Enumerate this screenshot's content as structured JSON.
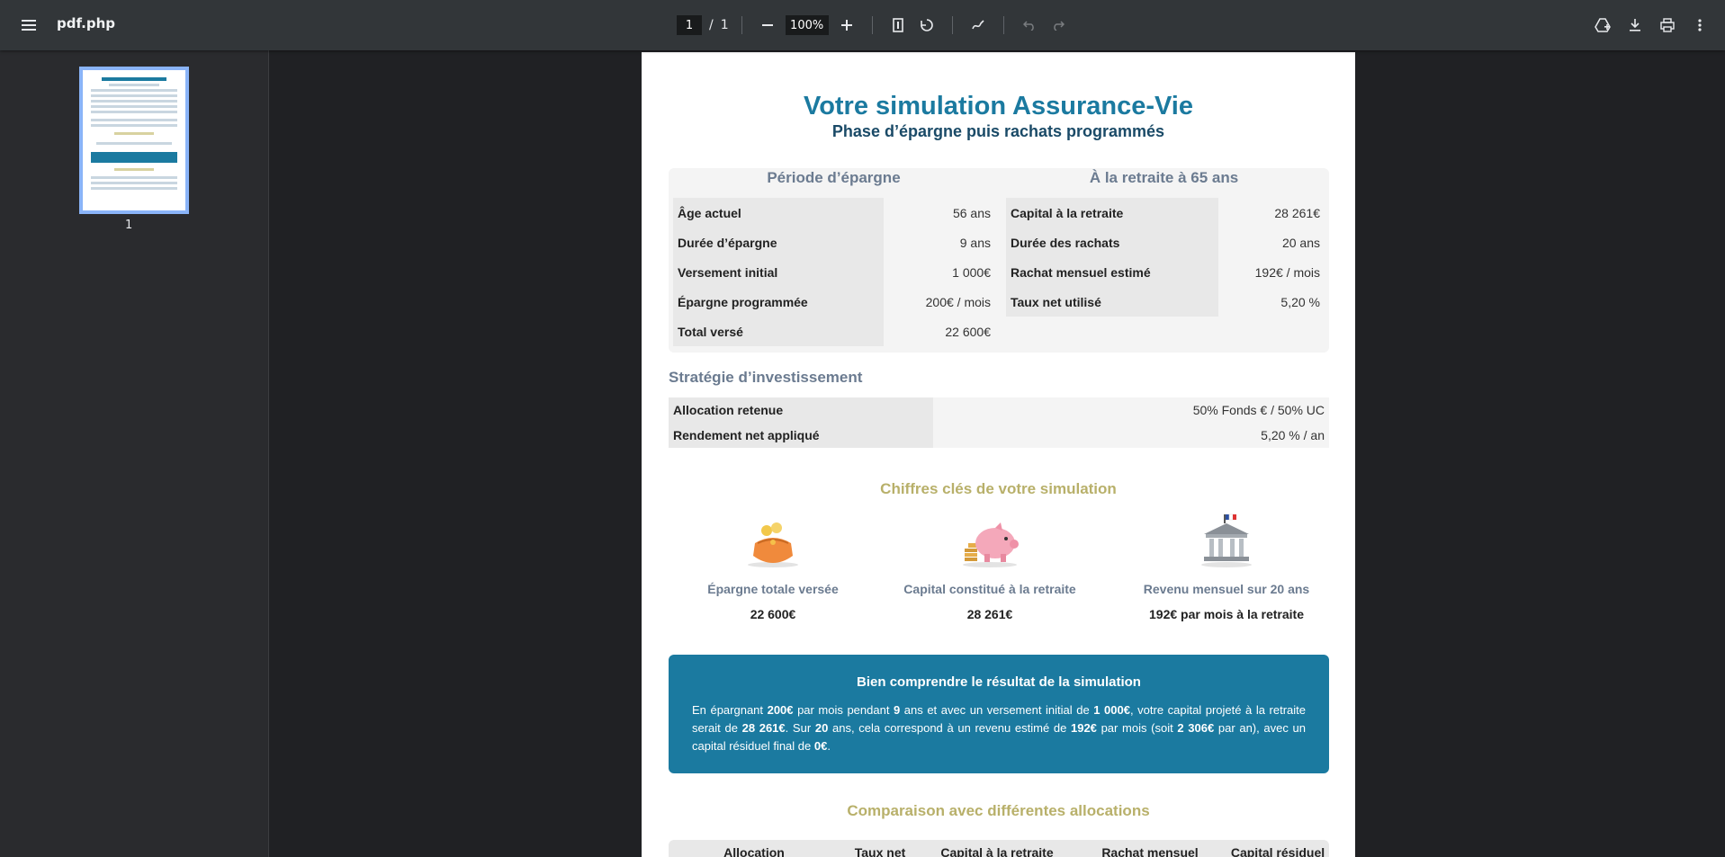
{
  "toolbar": {
    "title": "pdf.php",
    "page_current": "1",
    "page_separator": "/",
    "page_total": "1",
    "zoom": "100%"
  },
  "sidebar": {
    "thumbnail_label": "1"
  },
  "doc": {
    "title": "Votre simulation Assurance-Vie",
    "subtitle": "Phase d’épargne puis rachats programmés",
    "saving": {
      "heading": "Période d’épargne",
      "rows": [
        {
          "k": "Âge actuel",
          "v": "56 ans"
        },
        {
          "k": "Durée d’épargne",
          "v": "9 ans"
        },
        {
          "k": "Versement initial",
          "v": "1 000€"
        },
        {
          "k": "Épargne programmée",
          "v": "200€ / mois"
        },
        {
          "k": "Total versé",
          "v": "22 600€"
        }
      ]
    },
    "retirement": {
      "heading": "À la retraite à 65 ans",
      "rows": [
        {
          "k": "Capital à la retraite",
          "v": "28 261€"
        },
        {
          "k": "Durée des rachats",
          "v": "20 ans"
        },
        {
          "k": "Rachat mensuel estimé",
          "v": "192€ / mois"
        },
        {
          "k": "Taux net utilisé",
          "v": "5,20 %"
        }
      ]
    },
    "strategy": {
      "heading": "Stratégie d’investissement",
      "rows": [
        {
          "k": "Allocation retenue",
          "v": "50% Fonds € / 50% UC"
        },
        {
          "k": "Rendement net appliqué",
          "v": "5,20 % / an"
        }
      ]
    },
    "key_figures": {
      "heading": "Chiffres clés de votre simulation",
      "items": [
        {
          "icon": "coin-purse-icon",
          "label": "Épargne totale versée",
          "value": "22 600€"
        },
        {
          "icon": "piggy-bank-icon",
          "label": "Capital constitué à la retraite",
          "value": "28 261€"
        },
        {
          "icon": "bank-building-icon",
          "label": "Revenu mensuel sur 20 ans",
          "value": "192€ par mois à la retraite"
        }
      ]
    },
    "info": {
      "title": "Bien comprendre le résultat de la simulation",
      "parts": [
        "En épargnant ",
        "200€",
        " par mois pendant ",
        "9",
        " ans et avec un versement initial de ",
        "1 000€",
        ", votre capital projeté à la retraite serait de ",
        "28 261€",
        ". Sur ",
        "20",
        " ans, cela correspond à un revenu estimé de ",
        "192€",
        " par mois (soit ",
        "2 306€",
        " par an), avec un capital résiduel final de ",
        "0€",
        "."
      ]
    },
    "comparison": {
      "heading": "Comparaison avec différentes allocations",
      "columns": [
        "Allocation",
        "Taux net",
        "Capital à la retraite",
        "Rachat mensuel",
        "Capital résiduel"
      ]
    }
  },
  "colors": {
    "accent": "#1b7aa0",
    "navy": "#1a4a67",
    "olive": "#b8b06a",
    "slate": "#6b7b90"
  }
}
